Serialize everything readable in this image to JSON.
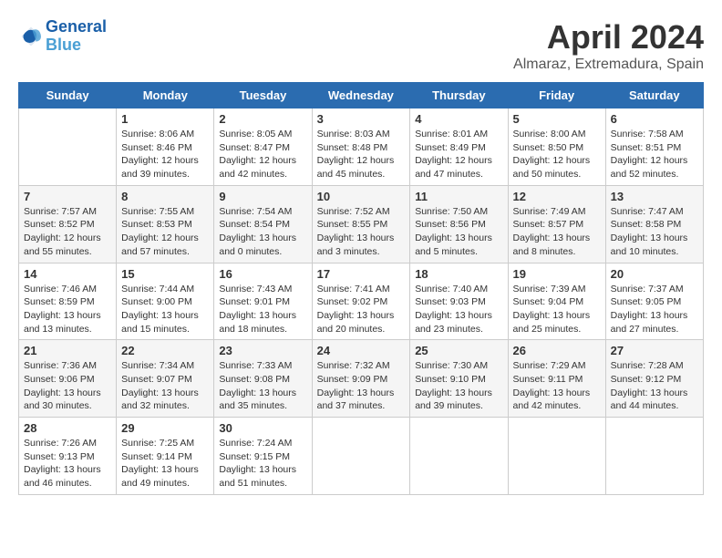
{
  "header": {
    "logo_line1": "General",
    "logo_line2": "Blue",
    "month": "April 2024",
    "location": "Almaraz, Extremadura, Spain"
  },
  "weekdays": [
    "Sunday",
    "Monday",
    "Tuesday",
    "Wednesday",
    "Thursday",
    "Friday",
    "Saturday"
  ],
  "weeks": [
    [
      {
        "day": "",
        "sunrise": "",
        "sunset": "",
        "daylight": ""
      },
      {
        "day": "1",
        "sunrise": "Sunrise: 8:06 AM",
        "sunset": "Sunset: 8:46 PM",
        "daylight": "Daylight: 12 hours and 39 minutes."
      },
      {
        "day": "2",
        "sunrise": "Sunrise: 8:05 AM",
        "sunset": "Sunset: 8:47 PM",
        "daylight": "Daylight: 12 hours and 42 minutes."
      },
      {
        "day": "3",
        "sunrise": "Sunrise: 8:03 AM",
        "sunset": "Sunset: 8:48 PM",
        "daylight": "Daylight: 12 hours and 45 minutes."
      },
      {
        "day": "4",
        "sunrise": "Sunrise: 8:01 AM",
        "sunset": "Sunset: 8:49 PM",
        "daylight": "Daylight: 12 hours and 47 minutes."
      },
      {
        "day": "5",
        "sunrise": "Sunrise: 8:00 AM",
        "sunset": "Sunset: 8:50 PM",
        "daylight": "Daylight: 12 hours and 50 minutes."
      },
      {
        "day": "6",
        "sunrise": "Sunrise: 7:58 AM",
        "sunset": "Sunset: 8:51 PM",
        "daylight": "Daylight: 12 hours and 52 minutes."
      }
    ],
    [
      {
        "day": "7",
        "sunrise": "Sunrise: 7:57 AM",
        "sunset": "Sunset: 8:52 PM",
        "daylight": "Daylight: 12 hours and 55 minutes."
      },
      {
        "day": "8",
        "sunrise": "Sunrise: 7:55 AM",
        "sunset": "Sunset: 8:53 PM",
        "daylight": "Daylight: 12 hours and 57 minutes."
      },
      {
        "day": "9",
        "sunrise": "Sunrise: 7:54 AM",
        "sunset": "Sunset: 8:54 PM",
        "daylight": "Daylight: 13 hours and 0 minutes."
      },
      {
        "day": "10",
        "sunrise": "Sunrise: 7:52 AM",
        "sunset": "Sunset: 8:55 PM",
        "daylight": "Daylight: 13 hours and 3 minutes."
      },
      {
        "day": "11",
        "sunrise": "Sunrise: 7:50 AM",
        "sunset": "Sunset: 8:56 PM",
        "daylight": "Daylight: 13 hours and 5 minutes."
      },
      {
        "day": "12",
        "sunrise": "Sunrise: 7:49 AM",
        "sunset": "Sunset: 8:57 PM",
        "daylight": "Daylight: 13 hours and 8 minutes."
      },
      {
        "day": "13",
        "sunrise": "Sunrise: 7:47 AM",
        "sunset": "Sunset: 8:58 PM",
        "daylight": "Daylight: 13 hours and 10 minutes."
      }
    ],
    [
      {
        "day": "14",
        "sunrise": "Sunrise: 7:46 AM",
        "sunset": "Sunset: 8:59 PM",
        "daylight": "Daylight: 13 hours and 13 minutes."
      },
      {
        "day": "15",
        "sunrise": "Sunrise: 7:44 AM",
        "sunset": "Sunset: 9:00 PM",
        "daylight": "Daylight: 13 hours and 15 minutes."
      },
      {
        "day": "16",
        "sunrise": "Sunrise: 7:43 AM",
        "sunset": "Sunset: 9:01 PM",
        "daylight": "Daylight: 13 hours and 18 minutes."
      },
      {
        "day": "17",
        "sunrise": "Sunrise: 7:41 AM",
        "sunset": "Sunset: 9:02 PM",
        "daylight": "Daylight: 13 hours and 20 minutes."
      },
      {
        "day": "18",
        "sunrise": "Sunrise: 7:40 AM",
        "sunset": "Sunset: 9:03 PM",
        "daylight": "Daylight: 13 hours and 23 minutes."
      },
      {
        "day": "19",
        "sunrise": "Sunrise: 7:39 AM",
        "sunset": "Sunset: 9:04 PM",
        "daylight": "Daylight: 13 hours and 25 minutes."
      },
      {
        "day": "20",
        "sunrise": "Sunrise: 7:37 AM",
        "sunset": "Sunset: 9:05 PM",
        "daylight": "Daylight: 13 hours and 27 minutes."
      }
    ],
    [
      {
        "day": "21",
        "sunrise": "Sunrise: 7:36 AM",
        "sunset": "Sunset: 9:06 PM",
        "daylight": "Daylight: 13 hours and 30 minutes."
      },
      {
        "day": "22",
        "sunrise": "Sunrise: 7:34 AM",
        "sunset": "Sunset: 9:07 PM",
        "daylight": "Daylight: 13 hours and 32 minutes."
      },
      {
        "day": "23",
        "sunrise": "Sunrise: 7:33 AM",
        "sunset": "Sunset: 9:08 PM",
        "daylight": "Daylight: 13 hours and 35 minutes."
      },
      {
        "day": "24",
        "sunrise": "Sunrise: 7:32 AM",
        "sunset": "Sunset: 9:09 PM",
        "daylight": "Daylight: 13 hours and 37 minutes."
      },
      {
        "day": "25",
        "sunrise": "Sunrise: 7:30 AM",
        "sunset": "Sunset: 9:10 PM",
        "daylight": "Daylight: 13 hours and 39 minutes."
      },
      {
        "day": "26",
        "sunrise": "Sunrise: 7:29 AM",
        "sunset": "Sunset: 9:11 PM",
        "daylight": "Daylight: 13 hours and 42 minutes."
      },
      {
        "day": "27",
        "sunrise": "Sunrise: 7:28 AM",
        "sunset": "Sunset: 9:12 PM",
        "daylight": "Daylight: 13 hours and 44 minutes."
      }
    ],
    [
      {
        "day": "28",
        "sunrise": "Sunrise: 7:26 AM",
        "sunset": "Sunset: 9:13 PM",
        "daylight": "Daylight: 13 hours and 46 minutes."
      },
      {
        "day": "29",
        "sunrise": "Sunrise: 7:25 AM",
        "sunset": "Sunset: 9:14 PM",
        "daylight": "Daylight: 13 hours and 49 minutes."
      },
      {
        "day": "30",
        "sunrise": "Sunrise: 7:24 AM",
        "sunset": "Sunset: 9:15 PM",
        "daylight": "Daylight: 13 hours and 51 minutes."
      },
      {
        "day": "",
        "sunrise": "",
        "sunset": "",
        "daylight": ""
      },
      {
        "day": "",
        "sunrise": "",
        "sunset": "",
        "daylight": ""
      },
      {
        "day": "",
        "sunrise": "",
        "sunset": "",
        "daylight": ""
      },
      {
        "day": "",
        "sunrise": "",
        "sunset": "",
        "daylight": ""
      }
    ]
  ]
}
